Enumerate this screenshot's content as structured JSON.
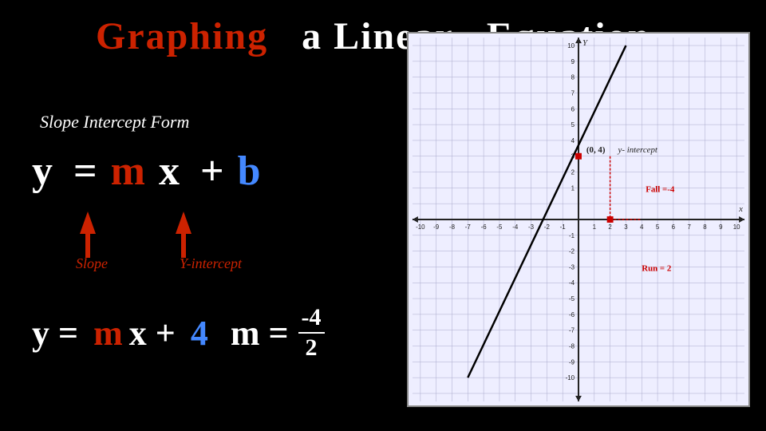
{
  "title": {
    "part1": "Graphing",
    "part2": "a Linear",
    "part3": "Equation"
  },
  "subtitle": "Slope Intercept Form",
  "equation": {
    "full": "y = m x + b",
    "label_slope": "Slope",
    "label_yint": "Y-intercept"
  },
  "equation_bottom": {
    "text": "y = mx +",
    "b_value": "4",
    "m_label": "m =",
    "numerator": "-4",
    "denominator": "2"
  },
  "graph": {
    "fall_label": "Fall =-4",
    "run_label": "Run = 2",
    "yint_label": "(0, 4)",
    "yint_sublabel": "y- intercept",
    "x_min": -10,
    "x_max": 10,
    "y_min": -10,
    "y_max": 10
  }
}
